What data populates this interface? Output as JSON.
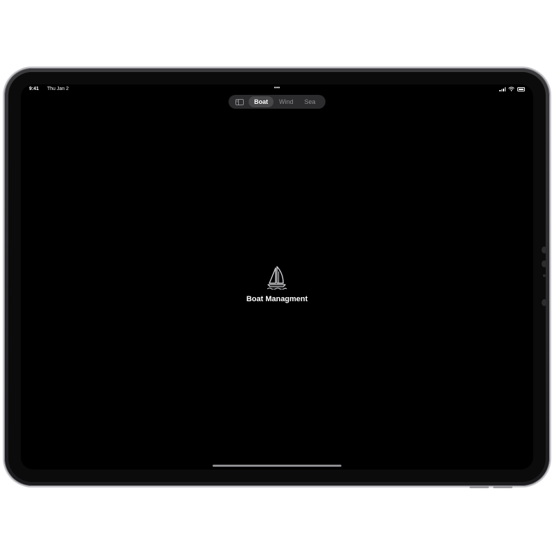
{
  "status_bar": {
    "time": "9:41",
    "date": "Thu Jan 2",
    "dots": "•••",
    "icons": [
      "cellular-signal-icon",
      "wifi-icon",
      "battery-icon"
    ]
  },
  "tab_bar": {
    "sidebar_icon": "sidebar-toggle-icon",
    "tabs": [
      {
        "label": "Boat",
        "selected": true
      },
      {
        "label": "Wind",
        "selected": false
      },
      {
        "label": "Sea",
        "selected": false
      }
    ]
  },
  "main": {
    "icon": "sailboat-icon",
    "title": "Boat Managment"
  },
  "colors": {
    "screen_background": "#000000",
    "tab_bar_background": "#2c2c2e",
    "active_tab_background": "#48484a",
    "inactive_tab_text": "#8e8e93",
    "primary_text": "#ffffff"
  }
}
